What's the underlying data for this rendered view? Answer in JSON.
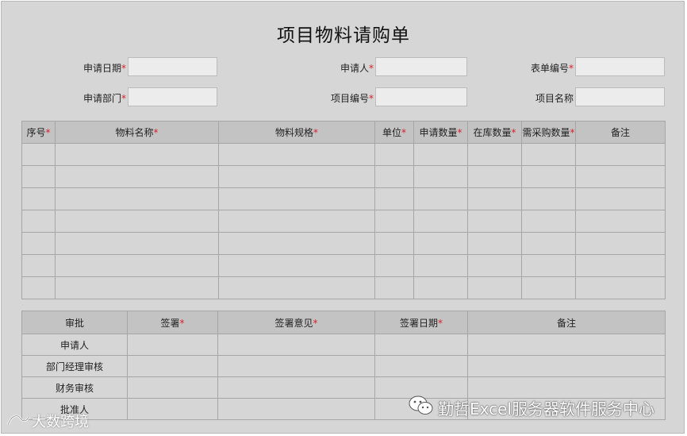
{
  "form": {
    "title": "项目物料请购单",
    "required_mark": "*",
    "fields": [
      {
        "label": "申请日期",
        "required": true,
        "value": ""
      },
      {
        "label": "申请人",
        "required": true,
        "value": ""
      },
      {
        "label": "表单编号",
        "required": true,
        "value": ""
      },
      {
        "label": "申请部门",
        "required": true,
        "value": ""
      },
      {
        "label": "项目编号",
        "required": true,
        "value": ""
      },
      {
        "label": "项目名称",
        "required": false,
        "value": ""
      }
    ]
  },
  "items_table": {
    "headers": [
      "序号",
      "物料名称",
      "物料规格",
      "单位",
      "申请数量",
      "在库数量",
      "需采购数量",
      "备注"
    ],
    "required": [
      true,
      true,
      true,
      true,
      true,
      true,
      true,
      false
    ],
    "row_count": 7
  },
  "approval_table": {
    "headers": [
      "审批",
      "签署",
      "签署意见",
      "签署日期",
      "备注"
    ],
    "required": [
      false,
      true,
      true,
      true,
      false
    ],
    "rows": [
      "申请人",
      "部门经理审核",
      "财务审核",
      "批准人"
    ]
  },
  "watermarks": {
    "right_text": "勤哲Excel服务器软件服务中心",
    "left_text": "大数跨境",
    "right_icon": "wechat-icon",
    "left_icon": "logo-icon"
  }
}
